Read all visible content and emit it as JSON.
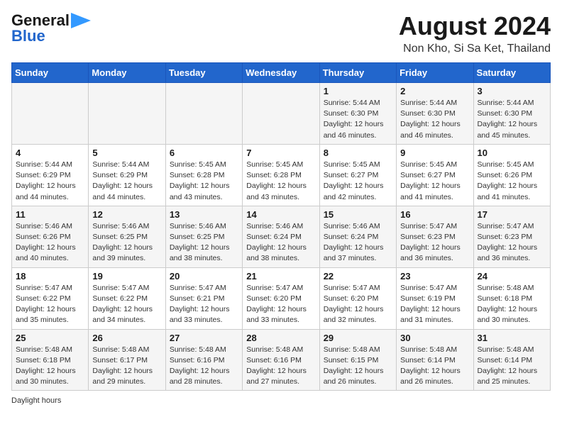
{
  "logo": {
    "line1": "General",
    "line2": "Blue"
  },
  "title": "August 2024",
  "subtitle": "Non Kho, Si Sa Ket, Thailand",
  "weekdays": [
    "Sunday",
    "Monday",
    "Tuesday",
    "Wednesday",
    "Thursday",
    "Friday",
    "Saturday"
  ],
  "weeks": [
    [
      {
        "day": "",
        "info": ""
      },
      {
        "day": "",
        "info": ""
      },
      {
        "day": "",
        "info": ""
      },
      {
        "day": "",
        "info": ""
      },
      {
        "day": "1",
        "info": "Sunrise: 5:44 AM\nSunset: 6:30 PM\nDaylight: 12 hours\nand 46 minutes."
      },
      {
        "day": "2",
        "info": "Sunrise: 5:44 AM\nSunset: 6:30 PM\nDaylight: 12 hours\nand 46 minutes."
      },
      {
        "day": "3",
        "info": "Sunrise: 5:44 AM\nSunset: 6:30 PM\nDaylight: 12 hours\nand 45 minutes."
      }
    ],
    [
      {
        "day": "4",
        "info": "Sunrise: 5:44 AM\nSunset: 6:29 PM\nDaylight: 12 hours\nand 44 minutes."
      },
      {
        "day": "5",
        "info": "Sunrise: 5:44 AM\nSunset: 6:29 PM\nDaylight: 12 hours\nand 44 minutes."
      },
      {
        "day": "6",
        "info": "Sunrise: 5:45 AM\nSunset: 6:28 PM\nDaylight: 12 hours\nand 43 minutes."
      },
      {
        "day": "7",
        "info": "Sunrise: 5:45 AM\nSunset: 6:28 PM\nDaylight: 12 hours\nand 43 minutes."
      },
      {
        "day": "8",
        "info": "Sunrise: 5:45 AM\nSunset: 6:27 PM\nDaylight: 12 hours\nand 42 minutes."
      },
      {
        "day": "9",
        "info": "Sunrise: 5:45 AM\nSunset: 6:27 PM\nDaylight: 12 hours\nand 41 minutes."
      },
      {
        "day": "10",
        "info": "Sunrise: 5:45 AM\nSunset: 6:26 PM\nDaylight: 12 hours\nand 41 minutes."
      }
    ],
    [
      {
        "day": "11",
        "info": "Sunrise: 5:46 AM\nSunset: 6:26 PM\nDaylight: 12 hours\nand 40 minutes."
      },
      {
        "day": "12",
        "info": "Sunrise: 5:46 AM\nSunset: 6:25 PM\nDaylight: 12 hours\nand 39 minutes."
      },
      {
        "day": "13",
        "info": "Sunrise: 5:46 AM\nSunset: 6:25 PM\nDaylight: 12 hours\nand 38 minutes."
      },
      {
        "day": "14",
        "info": "Sunrise: 5:46 AM\nSunset: 6:24 PM\nDaylight: 12 hours\nand 38 minutes."
      },
      {
        "day": "15",
        "info": "Sunrise: 5:46 AM\nSunset: 6:24 PM\nDaylight: 12 hours\nand 37 minutes."
      },
      {
        "day": "16",
        "info": "Sunrise: 5:47 AM\nSunset: 6:23 PM\nDaylight: 12 hours\nand 36 minutes."
      },
      {
        "day": "17",
        "info": "Sunrise: 5:47 AM\nSunset: 6:23 PM\nDaylight: 12 hours\nand 36 minutes."
      }
    ],
    [
      {
        "day": "18",
        "info": "Sunrise: 5:47 AM\nSunset: 6:22 PM\nDaylight: 12 hours\nand 35 minutes."
      },
      {
        "day": "19",
        "info": "Sunrise: 5:47 AM\nSunset: 6:22 PM\nDaylight: 12 hours\nand 34 minutes."
      },
      {
        "day": "20",
        "info": "Sunrise: 5:47 AM\nSunset: 6:21 PM\nDaylight: 12 hours\nand 33 minutes."
      },
      {
        "day": "21",
        "info": "Sunrise: 5:47 AM\nSunset: 6:20 PM\nDaylight: 12 hours\nand 33 minutes."
      },
      {
        "day": "22",
        "info": "Sunrise: 5:47 AM\nSunset: 6:20 PM\nDaylight: 12 hours\nand 32 minutes."
      },
      {
        "day": "23",
        "info": "Sunrise: 5:47 AM\nSunset: 6:19 PM\nDaylight: 12 hours\nand 31 minutes."
      },
      {
        "day": "24",
        "info": "Sunrise: 5:48 AM\nSunset: 6:18 PM\nDaylight: 12 hours\nand 30 minutes."
      }
    ],
    [
      {
        "day": "25",
        "info": "Sunrise: 5:48 AM\nSunset: 6:18 PM\nDaylight: 12 hours\nand 30 minutes."
      },
      {
        "day": "26",
        "info": "Sunrise: 5:48 AM\nSunset: 6:17 PM\nDaylight: 12 hours\nand 29 minutes."
      },
      {
        "day": "27",
        "info": "Sunrise: 5:48 AM\nSunset: 6:16 PM\nDaylight: 12 hours\nand 28 minutes."
      },
      {
        "day": "28",
        "info": "Sunrise: 5:48 AM\nSunset: 6:16 PM\nDaylight: 12 hours\nand 27 minutes."
      },
      {
        "day": "29",
        "info": "Sunrise: 5:48 AM\nSunset: 6:15 PM\nDaylight: 12 hours\nand 26 minutes."
      },
      {
        "day": "30",
        "info": "Sunrise: 5:48 AM\nSunset: 6:14 PM\nDaylight: 12 hours\nand 26 minutes."
      },
      {
        "day": "31",
        "info": "Sunrise: 5:48 AM\nSunset: 6:14 PM\nDaylight: 12 hours\nand 25 minutes."
      }
    ]
  ],
  "footer": "Daylight hours"
}
